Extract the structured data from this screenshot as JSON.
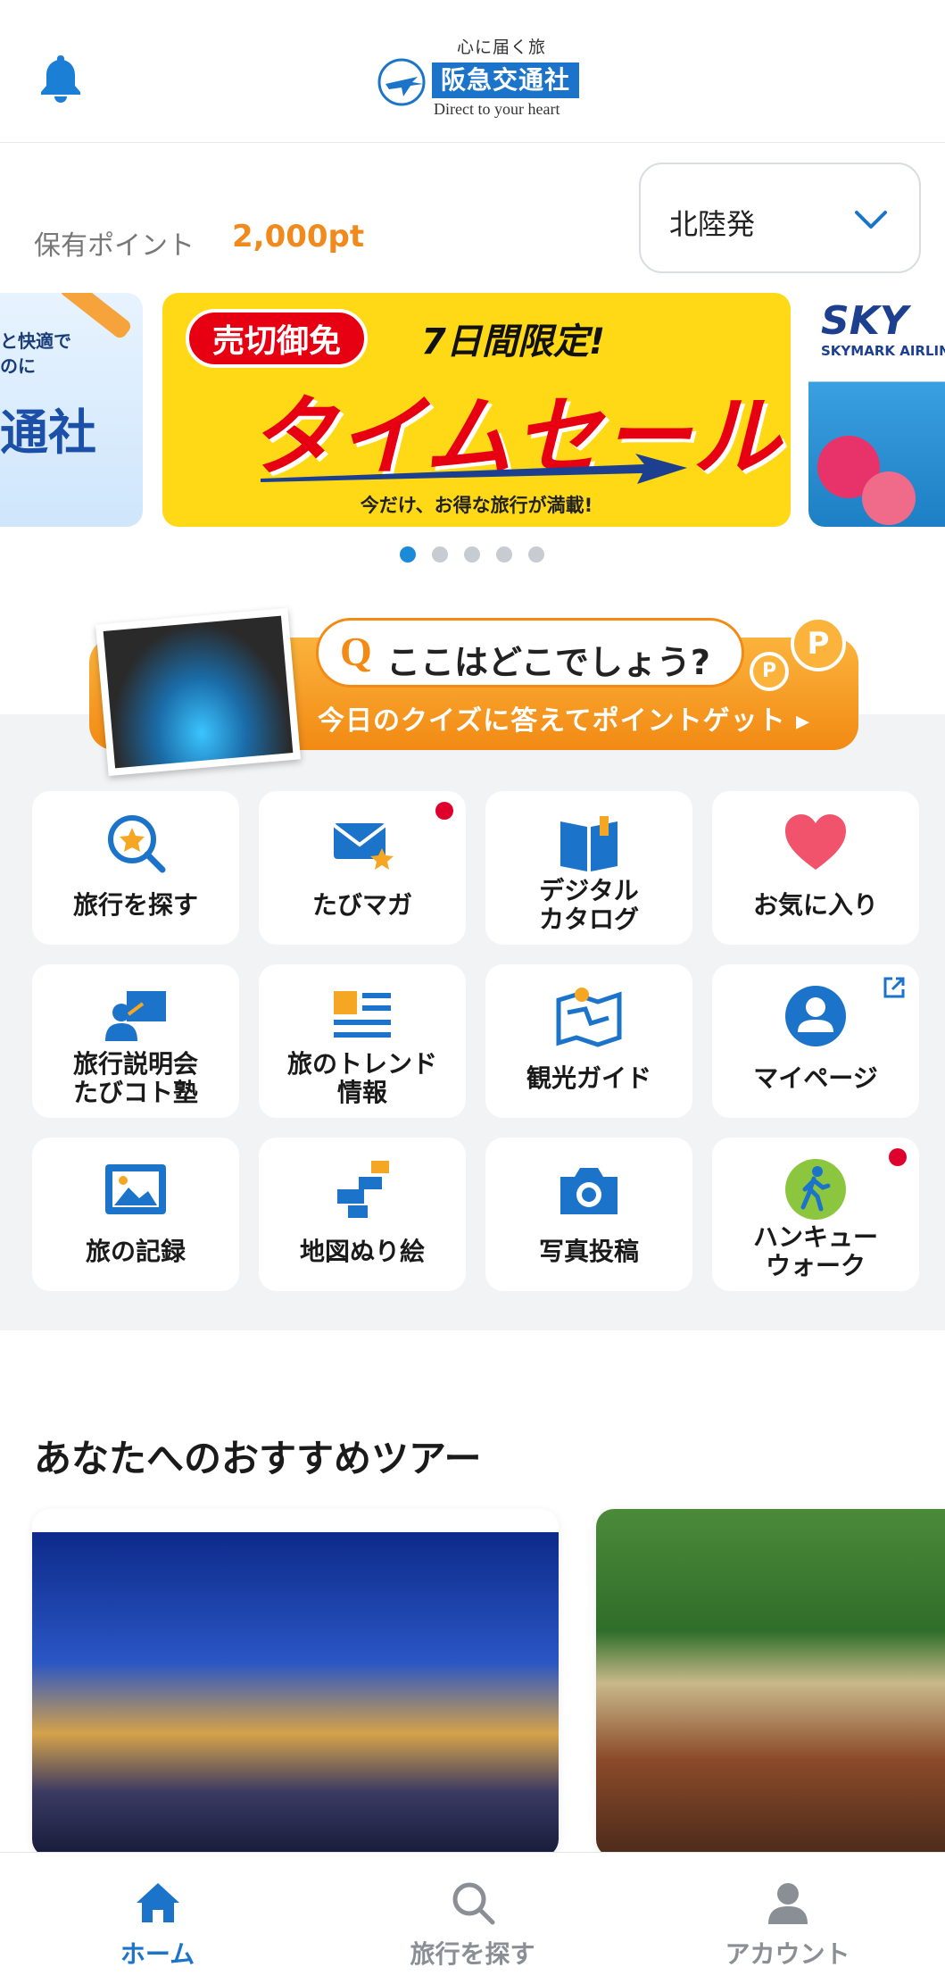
{
  "header": {
    "logo_tagline": "心に届く旅",
    "logo_name": "阪急交通社",
    "logo_sub": "Direct to your heart"
  },
  "points": {
    "label": "保有ポイント",
    "value": "2,000pt"
  },
  "region": {
    "label": "北陸発"
  },
  "carousel": {
    "left": {
      "line1": "と快適で",
      "line2": "のに",
      "line3": "通社"
    },
    "main": {
      "badge": "売切御免",
      "limited": "7日間限定!",
      "headline": "タイムセール",
      "sub": "今だけ、お得な旅行が満載!"
    },
    "right": {
      "brand": "SKY",
      "brand_sub": "SKYMARK AIRLINE"
    },
    "active_index": 0,
    "count": 5
  },
  "quiz": {
    "q_mark": "Q",
    "question": "ここはどこでしょう?",
    "sub": "今日のクイズに答えてポイントゲット ▸",
    "coin_label": "P"
  },
  "menu": [
    {
      "label": "旅行を探す",
      "icon": "search-star-icon",
      "badge": false
    },
    {
      "label": "たびマガ",
      "icon": "mail-star-icon",
      "badge": true
    },
    {
      "label": "デジタル\nカタログ",
      "icon": "book-icon",
      "badge": false
    },
    {
      "label": "お気に入り",
      "icon": "heart-icon",
      "badge": false
    },
    {
      "label": "旅行説明会\nたびコト塾",
      "icon": "presentation-icon",
      "badge": false
    },
    {
      "label": "旅のトレンド\n情報",
      "icon": "news-icon",
      "badge": false
    },
    {
      "label": "観光ガイド",
      "icon": "map-icon",
      "badge": false
    },
    {
      "label": "マイページ",
      "icon": "user-icon",
      "badge": false,
      "external": true
    },
    {
      "label": "旅の記録",
      "icon": "photo-icon",
      "badge": false
    },
    {
      "label": "地図ぬり絵",
      "icon": "blocks-icon",
      "badge": false
    },
    {
      "label": "写真投稿",
      "icon": "camera-icon",
      "badge": false
    },
    {
      "label": "ハンキュー\nウォーク",
      "icon": "walk-icon",
      "badge": true
    }
  ],
  "recommend": {
    "title": "あなたへのおすすめツアー"
  },
  "nav": {
    "items": [
      {
        "label": "ホーム",
        "icon": "home-icon",
        "active": true
      },
      {
        "label": "旅行を探す",
        "icon": "search-icon",
        "active": false
      },
      {
        "label": "アカウント",
        "icon": "account-icon",
        "active": false
      }
    ]
  },
  "colors": {
    "primary": "#1b74c9",
    "accent_orange": "#f08a1c",
    "sale_yellow": "#ffd915",
    "sale_red": "#e60012",
    "notify_red": "#e0002c",
    "nav_inactive": "#8a8f96"
  }
}
